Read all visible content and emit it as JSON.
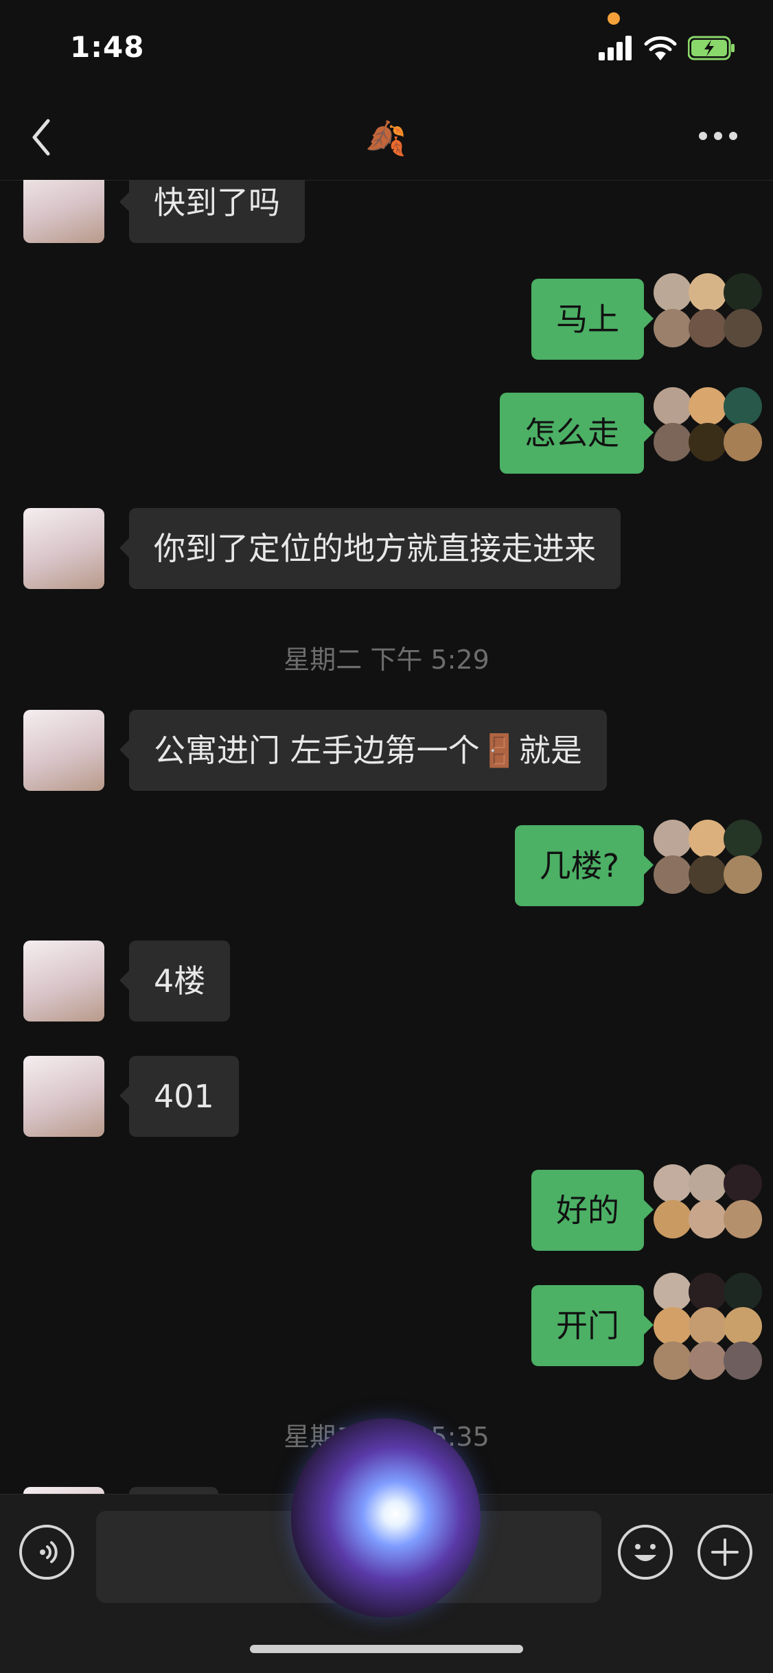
{
  "status_bar": {
    "time": "1:48"
  },
  "nav": {
    "title_icon": "🍂"
  },
  "messages": [
    {
      "side": "in",
      "text": "快到了吗"
    },
    {
      "side": "out",
      "text": "马上"
    },
    {
      "side": "out",
      "text": "怎么走"
    },
    {
      "side": "in",
      "text": "你到了定位的地方就直接走进来"
    },
    {
      "side": "in",
      "text": "公寓进门 左手边第一个🚪就是"
    },
    {
      "side": "out",
      "text": "几楼?"
    },
    {
      "side": "in",
      "text": "4楼"
    },
    {
      "side": "in",
      "text": "401"
    },
    {
      "side": "out",
      "text": "好的"
    },
    {
      "side": "out",
      "text": "开门"
    }
  ],
  "timestamps": [
    {
      "text": "星期二 下午 5:29"
    },
    {
      "text": "星期二 下午 5:35"
    }
  ],
  "input": {
    "placeholder": ""
  },
  "colors": {
    "background": "#111111",
    "incoming_bubble": "#2c2c2c",
    "outgoing_bubble": "#4cb065",
    "timestamp_text": "#6d6d6d"
  }
}
